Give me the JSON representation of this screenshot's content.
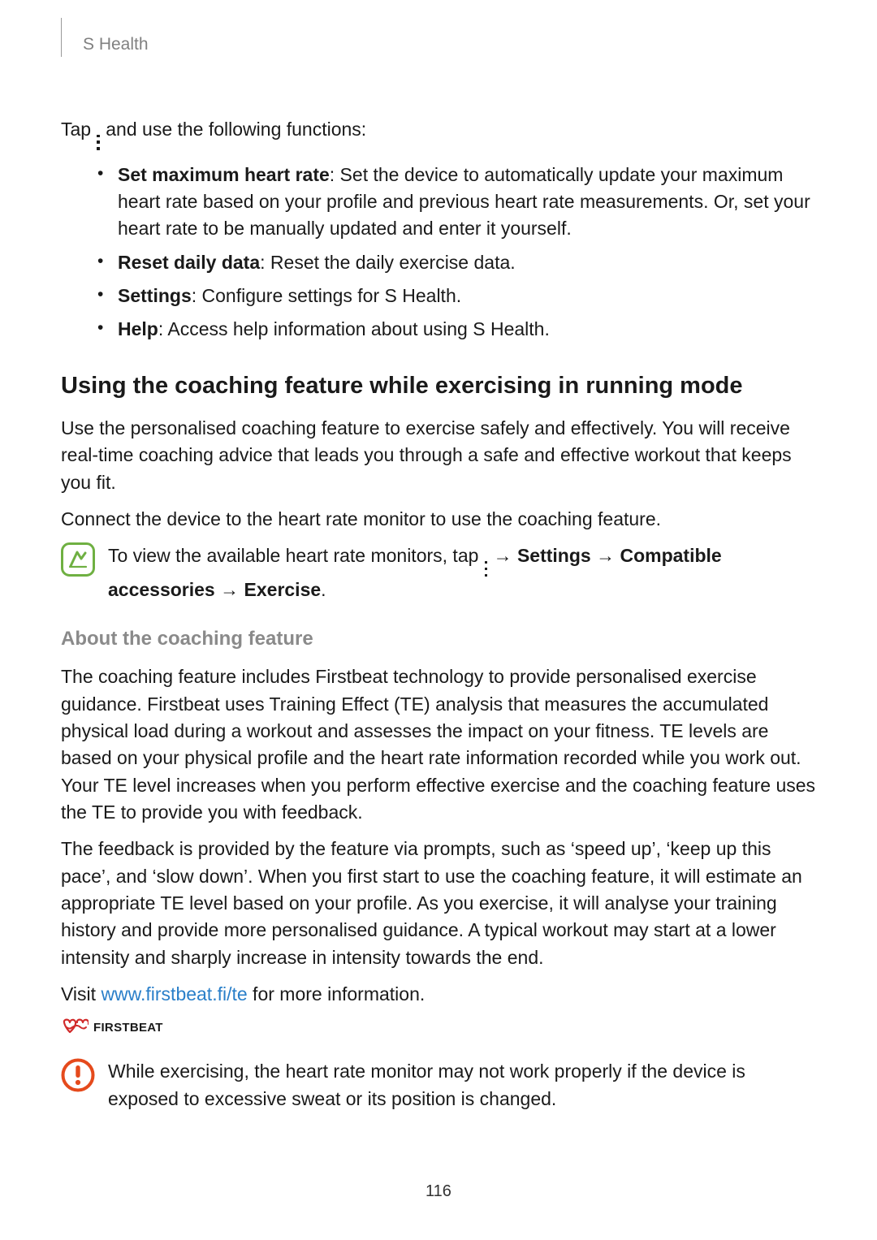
{
  "header": {
    "section": "S Health"
  },
  "intro": {
    "pre": "Tap ",
    "post": " and use the following functions:"
  },
  "functions": [
    {
      "term": "Set maximum heart rate",
      "desc": ": Set the device to automatically update your maximum heart rate based on your profile and previous heart rate measurements. Or, set your heart rate to be manually updated and enter it yourself."
    },
    {
      "term": "Reset daily data",
      "desc": ": Reset the daily exercise data."
    },
    {
      "term": "Settings",
      "desc": ": Configure settings for S Health."
    },
    {
      "term": "Help",
      "desc": ": Access help information about using S Health."
    }
  ],
  "coaching": {
    "heading": "Using the coaching feature while exercising in running mode",
    "p1": "Use the personalised coaching feature to exercise safely and effectively. You will receive real-time coaching advice that leads you through a safe and effective workout that keeps you fit.",
    "p2": "Connect the device to the heart rate monitor to use the coaching feature."
  },
  "note": {
    "pre": "To view the available heart rate monitors, tap ",
    "arrow": " → ",
    "b1": "Settings",
    "b2": "Compatible accessories",
    "b3": "Exercise",
    "end": "."
  },
  "about": {
    "heading": "About the coaching feature",
    "p1": "The coaching feature includes Firstbeat technology to provide personalised exercise guidance. Firstbeat uses Training Effect (TE) analysis that measures the accumulated physical load during a workout and assesses the impact on your fitness. TE levels are based on your physical profile and the heart rate information recorded while you work out. Your TE level increases when you perform effective exercise and the coaching feature uses the TE to provide you with feedback.",
    "p2": "The feedback is provided by the feature via prompts, such as ‘speed up’, ‘keep up this pace’, and ‘slow down’. When you first start to use the coaching feature, it will estimate an appropriate TE level based on your profile. As you exercise, it will analyse your training history and provide more personalised guidance. A typical workout may start at a lower intensity and sharply increase in intensity towards the end.",
    "visit_pre": "Visit ",
    "visit_link": "www.firstbeat.fi/te",
    "visit_post": " for more information."
  },
  "firstbeat_label": "FIRSTBEAT",
  "caution": "While exercising, the heart rate monitor may not work properly if the device is exposed to excessive sweat or its position is changed.",
  "page_number": "116"
}
